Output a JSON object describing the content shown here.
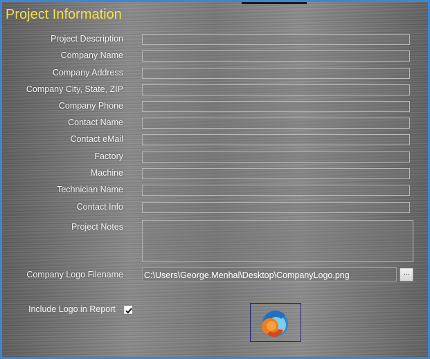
{
  "panel": {
    "title": "Project Information",
    "accent_color": "#3d86d6",
    "title_color": "#f5e04a"
  },
  "fields": [
    {
      "label": "Project Description",
      "value": ""
    },
    {
      "label": "Company Name",
      "value": ""
    },
    {
      "label": "Company Address",
      "value": ""
    },
    {
      "label": "Company City, State, ZIP",
      "value": ""
    },
    {
      "label": "Company Phone",
      "value": ""
    },
    {
      "label": "Contact Name",
      "value": ""
    },
    {
      "label": "Contact eMail",
      "value": ""
    },
    {
      "label": "Factory",
      "value": ""
    },
    {
      "label": "Machine",
      "value": ""
    },
    {
      "label": "Technician Name",
      "value": ""
    },
    {
      "label": "Contact Info",
      "value": ""
    }
  ],
  "notes": {
    "label": "Project Notes",
    "value": ""
  },
  "logo": {
    "label": "Company Logo Filename",
    "value": "C:\\Users\\George.Menhal\\Desktop\\CompanyLogo.png",
    "browse_label": "...",
    "preview_icon": "company-logo-icon"
  },
  "include_logo": {
    "label": "Include Logo in Report",
    "checked": true
  }
}
